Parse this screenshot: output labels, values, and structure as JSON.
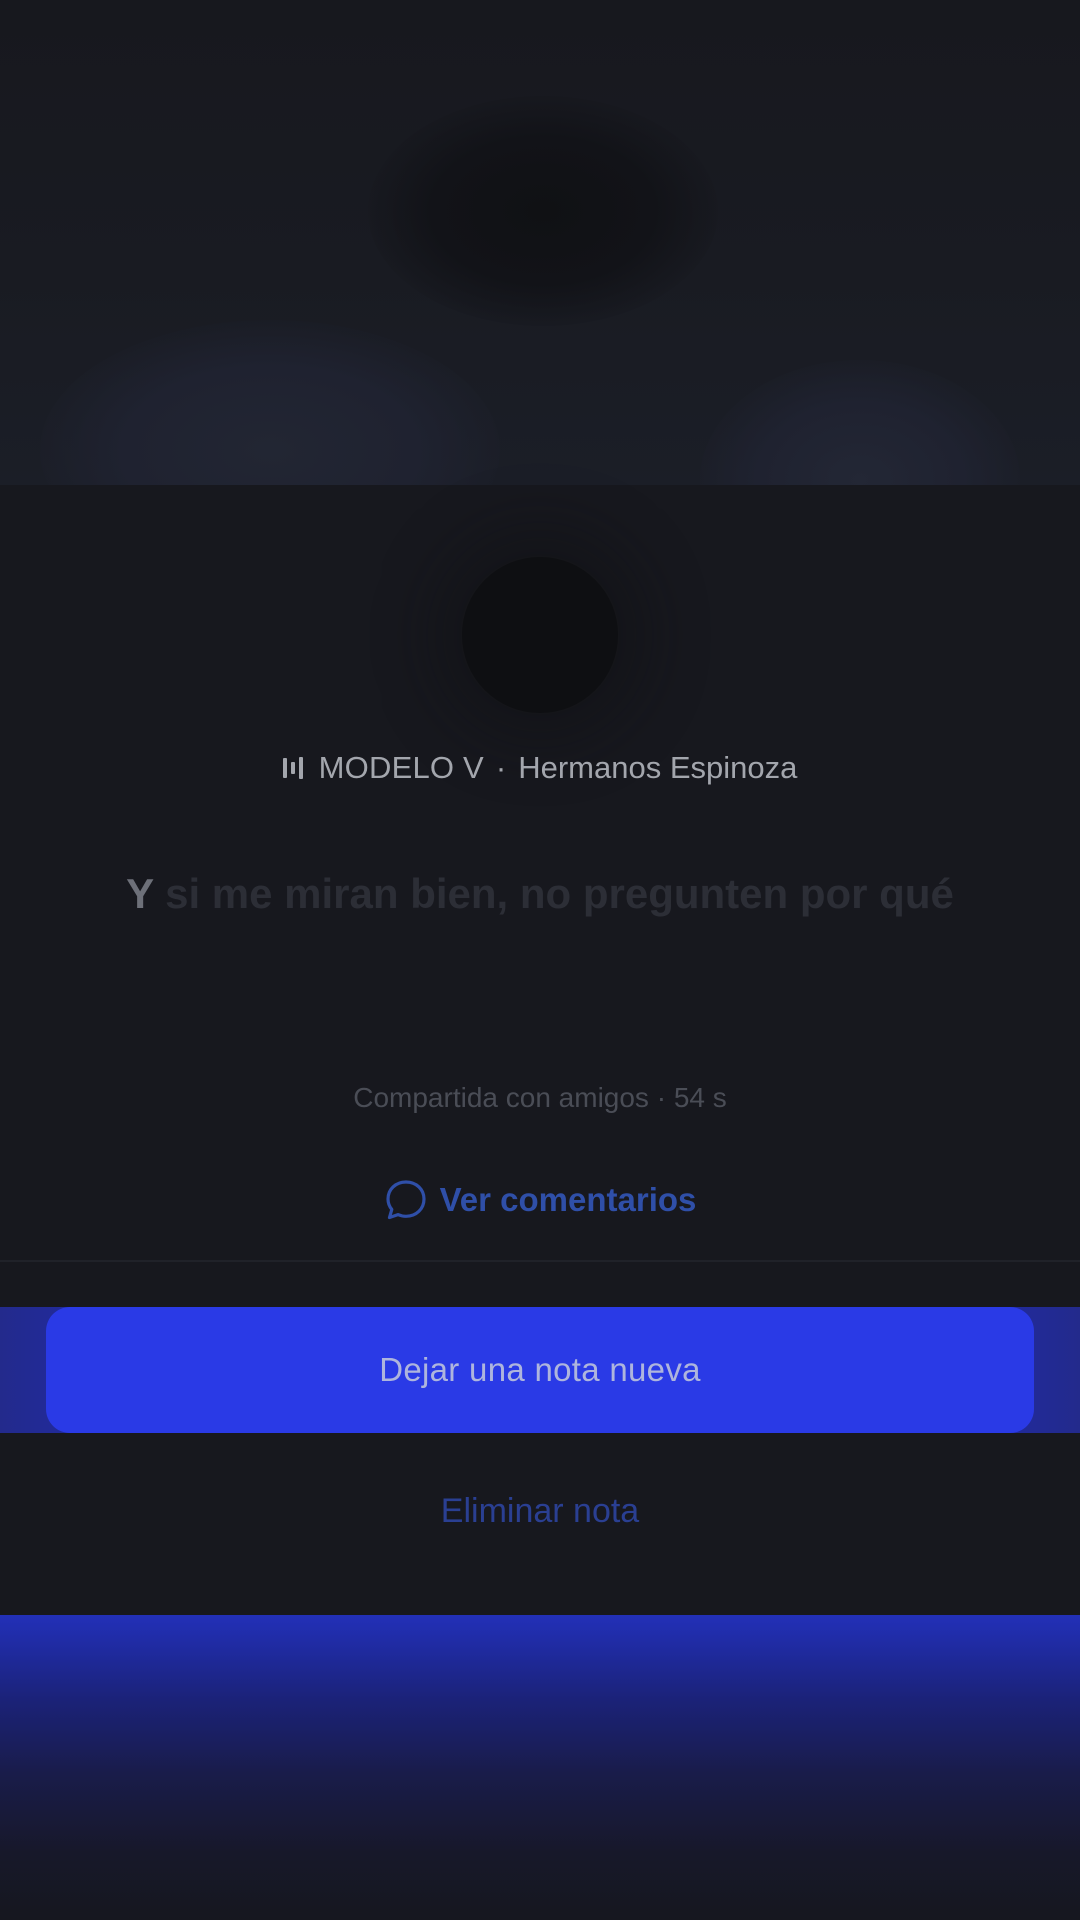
{
  "note": {
    "song": {
      "icon": "music-bars-icon",
      "title": "MODELO V",
      "separator": "·",
      "artist": "Hermanos Espinoza"
    },
    "lyrics": {
      "active": "Y",
      "rest": " si me miran bien, no pregunten por qué"
    },
    "meta": "Compartida con amigos · 54 s",
    "comments": {
      "icon": "speech-bubble-icon",
      "label": "Ver comentarios"
    }
  },
  "actions": {
    "primary_label": "Dejar una nota nueva",
    "delete_label": "Eliminar nota"
  },
  "colors": {
    "background": "#16171d",
    "accent": "#2a3ae6",
    "link": "#2f4fa8"
  }
}
